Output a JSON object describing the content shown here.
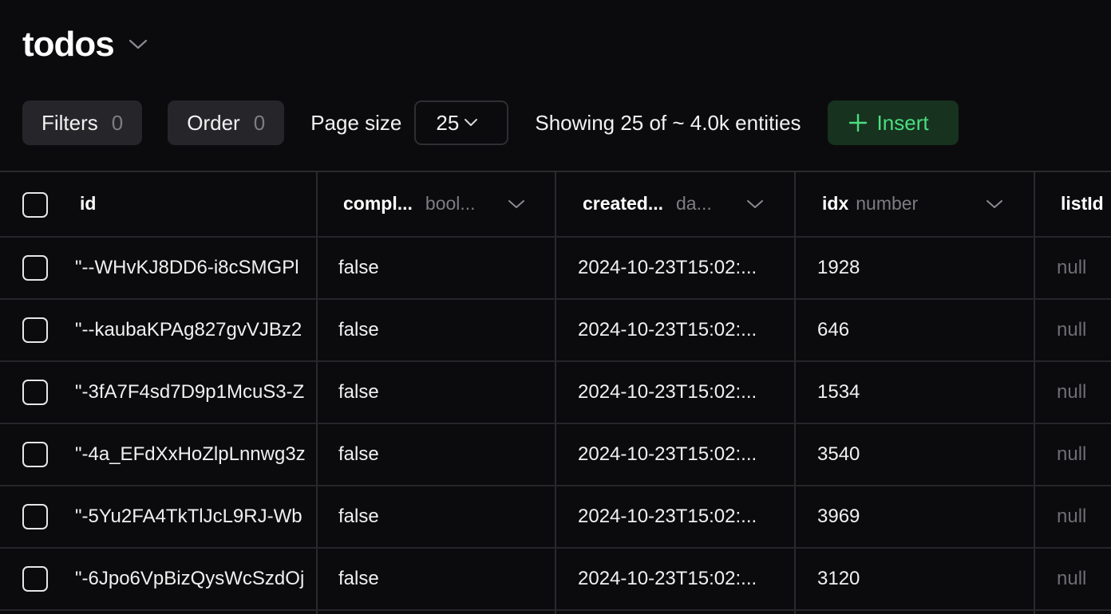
{
  "header": {
    "title": "todos"
  },
  "toolbar": {
    "filters_label": "Filters",
    "filters_count": "0",
    "order_label": "Order",
    "order_count": "0",
    "page_size_label": "Page size",
    "page_size_value": "25",
    "showing_text": "Showing 25 of ~ 4.0k entities",
    "insert_label": "Insert"
  },
  "table": {
    "columns": [
      {
        "name": "id",
        "type": ""
      },
      {
        "name": "compl...",
        "type": "bool..."
      },
      {
        "name": "created...",
        "type": "da..."
      },
      {
        "name": "idx",
        "type": "number"
      },
      {
        "name": "listId",
        "type": ""
      }
    ],
    "rows": [
      {
        "id": "\"--WHvKJ8DD6-i8cSMGPl",
        "completed": "false",
        "created": "2024-10-23T15:02:...",
        "idx": "1928",
        "listId": "null"
      },
      {
        "id": "\"--kaubaKPAg827gvVJBz2",
        "completed": "false",
        "created": "2024-10-23T15:02:...",
        "idx": "646",
        "listId": "null"
      },
      {
        "id": "\"-3fA7F4sd7D9p1McuS3-Z",
        "completed": "false",
        "created": "2024-10-23T15:02:...",
        "idx": "1534",
        "listId": "null"
      },
      {
        "id": "\"-4a_EFdXxHoZlpLnnwg3z",
        "completed": "false",
        "created": "2024-10-23T15:02:...",
        "idx": "3540",
        "listId": "null"
      },
      {
        "id": "\"-5Yu2FA4TkTlJcL9RJ-Wb",
        "completed": "false",
        "created": "2024-10-23T15:02:...",
        "idx": "3969",
        "listId": "null"
      },
      {
        "id": "\"-6Jpo6VpBizQysWcSzdOj",
        "completed": "false",
        "created": "2024-10-23T15:02:...",
        "idx": "3120",
        "listId": "null"
      }
    ]
  },
  "colors": {
    "background": "#0b0b0d",
    "insert_bg": "#17321f",
    "insert_fg": "#4ade80",
    "muted": "#7d7d82"
  }
}
